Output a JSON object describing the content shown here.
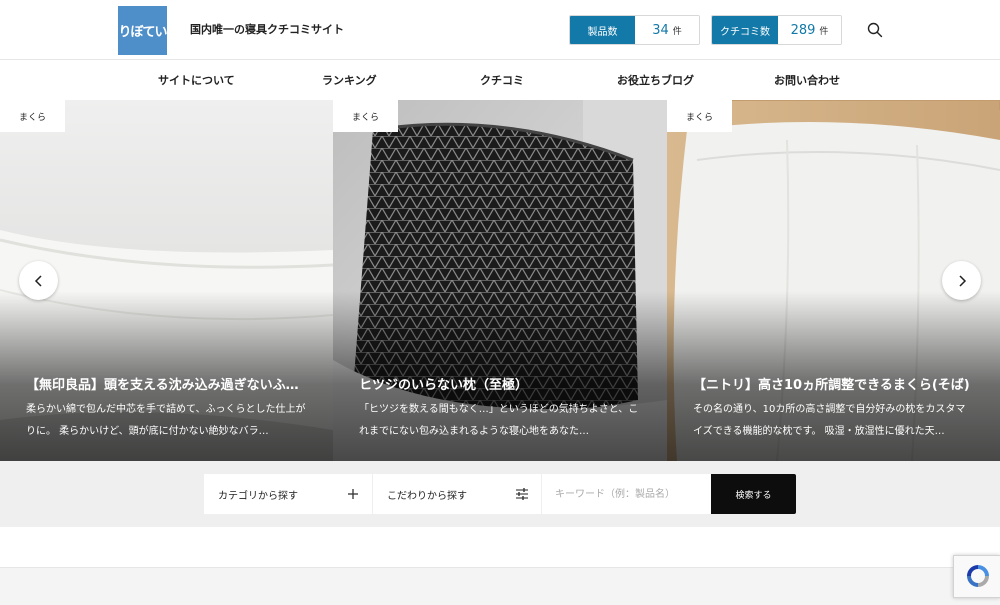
{
  "header": {
    "logo_text": "りぼてい",
    "tagline": "国内唯一の寝具クチコミサイト",
    "products": {
      "label": "製品数",
      "count": "34",
      "unit": "件"
    },
    "reviews": {
      "label": "クチコミ数",
      "count": "289",
      "unit": "件"
    },
    "search_icon": "search-icon"
  },
  "nav": {
    "items": [
      {
        "label": "サイトについて"
      },
      {
        "label": "ランキング"
      },
      {
        "label": "クチコミ"
      },
      {
        "label": "お役立ちブログ"
      },
      {
        "label": "お問い合わせ"
      }
    ]
  },
  "slider": {
    "slides": [
      {
        "category": "まくら",
        "title": "【無印良品】頭を支える沈み込み過ぎないふ…",
        "desc": "柔らかい綿で包んだ中芯を手で詰めて、ふっくらとした仕上がりに。 柔らかいけど、頭が底に付かない絶妙なバラ…"
      },
      {
        "category": "まくら",
        "title": "ヒツジのいらない枕（至極）",
        "desc": "「ヒツジを数える間もなく…」というほどの気持ちよさと、これまでにない包み込まれるような寝心地をあなた…"
      },
      {
        "category": "まくら",
        "title": "【ニトリ】高さ10ヵ所調整できるまくら(そば)",
        "desc": "その名の通り、10カ所の高さ調整で自分好みの枕をカスタマイズできる機能的な枕です。 吸湿・放湿性に優れた天…"
      }
    ],
    "prev_icon": "chevron-left-icon",
    "next_icon": "chevron-right-icon"
  },
  "search_bar": {
    "category_label": "カテゴリから探す",
    "preference_label": "こだわりから探す",
    "keyword_placeholder": "キーワード（例：製品名）",
    "submit_label": "検索する"
  },
  "colors": {
    "accent": "#1379a8",
    "logo_bg": "#4f8fc9",
    "search_button": "#0d0d0d",
    "band_bg": "#efefef"
  }
}
